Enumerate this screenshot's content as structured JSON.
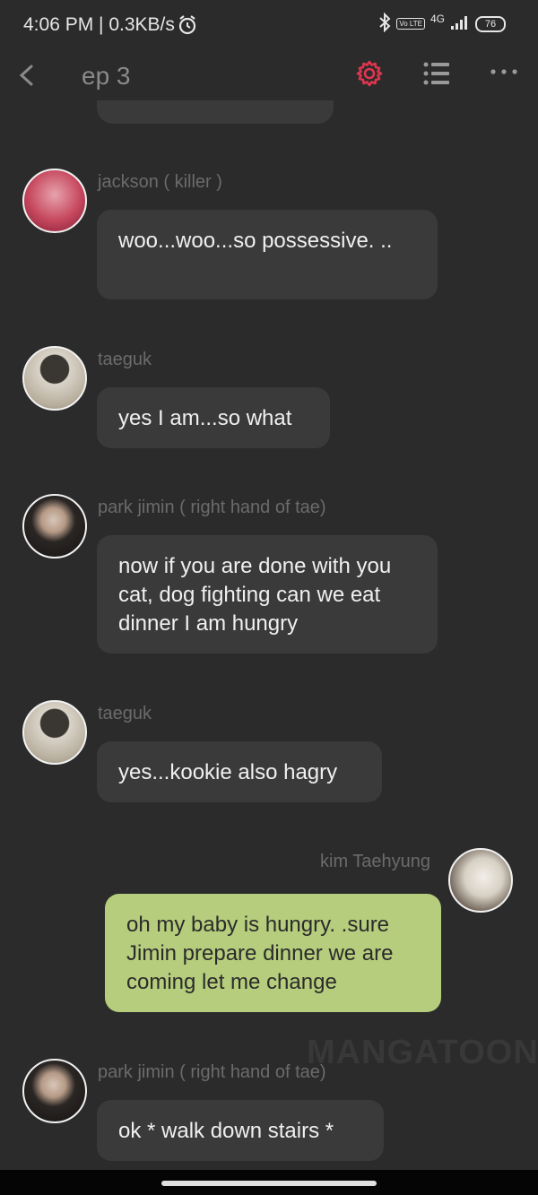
{
  "status_bar": {
    "time_speed": "4:06 PM | 0.3KB/s",
    "network": "4G",
    "volte": "Vo LTE",
    "battery": "76"
  },
  "header": {
    "title": "ep 3",
    "accent_color": "#e0354f"
  },
  "messages": [
    {
      "sender": "jackson ( killer )",
      "text": "woo...woo...so possessive. .."
    },
    {
      "sender": "taeguk",
      "text": "yes I am...so what"
    },
    {
      "sender": "park jimin ( right hand of tae)",
      "text": "now if you are done with you cat, dog fighting can we eat dinner I am hungry"
    },
    {
      "sender": "taeguk",
      "text": "yes...kookie also hagry"
    },
    {
      "sender": "kim Taehyung",
      "text": "oh my baby is hungry. .sure Jimin prepare dinner we are coming let me change",
      "outgoing": true
    },
    {
      "sender": "park jimin ( right hand of tae)",
      "text": "ok * walk down stairs *"
    }
  ],
  "watermark": "MANGATOON"
}
